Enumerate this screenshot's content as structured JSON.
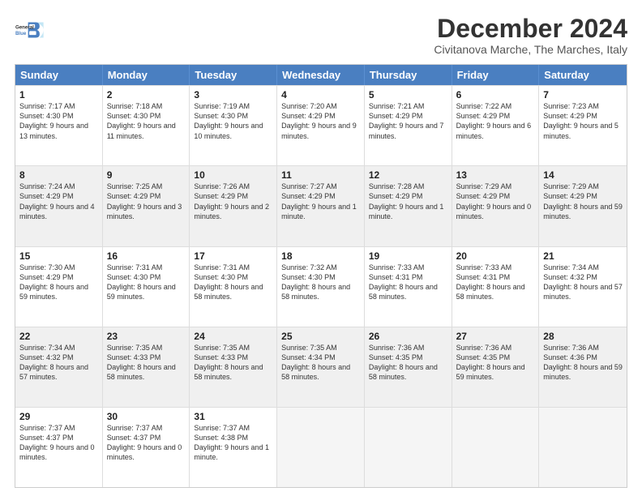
{
  "logo": {
    "line1": "General",
    "line2": "Blue"
  },
  "title": "December 2024",
  "subtitle": "Civitanova Marche, The Marches, Italy",
  "days": [
    "Sunday",
    "Monday",
    "Tuesday",
    "Wednesday",
    "Thursday",
    "Friday",
    "Saturday"
  ],
  "weeks": [
    [
      {
        "day": "1",
        "info": "Sunrise: 7:17 AM\nSunset: 4:30 PM\nDaylight: 9 hours and 13 minutes.",
        "shade": false
      },
      {
        "day": "2",
        "info": "Sunrise: 7:18 AM\nSunset: 4:30 PM\nDaylight: 9 hours and 11 minutes.",
        "shade": false
      },
      {
        "day": "3",
        "info": "Sunrise: 7:19 AM\nSunset: 4:30 PM\nDaylight: 9 hours and 10 minutes.",
        "shade": false
      },
      {
        "day": "4",
        "info": "Sunrise: 7:20 AM\nSunset: 4:29 PM\nDaylight: 9 hours and 9 minutes.",
        "shade": false
      },
      {
        "day": "5",
        "info": "Sunrise: 7:21 AM\nSunset: 4:29 PM\nDaylight: 9 hours and 7 minutes.",
        "shade": false
      },
      {
        "day": "6",
        "info": "Sunrise: 7:22 AM\nSunset: 4:29 PM\nDaylight: 9 hours and 6 minutes.",
        "shade": false
      },
      {
        "day": "7",
        "info": "Sunrise: 7:23 AM\nSunset: 4:29 PM\nDaylight: 9 hours and 5 minutes.",
        "shade": false
      }
    ],
    [
      {
        "day": "8",
        "info": "Sunrise: 7:24 AM\nSunset: 4:29 PM\nDaylight: 9 hours and 4 minutes.",
        "shade": true
      },
      {
        "day": "9",
        "info": "Sunrise: 7:25 AM\nSunset: 4:29 PM\nDaylight: 9 hours and 3 minutes.",
        "shade": true
      },
      {
        "day": "10",
        "info": "Sunrise: 7:26 AM\nSunset: 4:29 PM\nDaylight: 9 hours and 2 minutes.",
        "shade": true
      },
      {
        "day": "11",
        "info": "Sunrise: 7:27 AM\nSunset: 4:29 PM\nDaylight: 9 hours and 1 minute.",
        "shade": true
      },
      {
        "day": "12",
        "info": "Sunrise: 7:28 AM\nSunset: 4:29 PM\nDaylight: 9 hours and 1 minute.",
        "shade": true
      },
      {
        "day": "13",
        "info": "Sunrise: 7:29 AM\nSunset: 4:29 PM\nDaylight: 9 hours and 0 minutes.",
        "shade": true
      },
      {
        "day": "14",
        "info": "Sunrise: 7:29 AM\nSunset: 4:29 PM\nDaylight: 8 hours and 59 minutes.",
        "shade": true
      }
    ],
    [
      {
        "day": "15",
        "info": "Sunrise: 7:30 AM\nSunset: 4:29 PM\nDaylight: 8 hours and 59 minutes.",
        "shade": false
      },
      {
        "day": "16",
        "info": "Sunrise: 7:31 AM\nSunset: 4:30 PM\nDaylight: 8 hours and 59 minutes.",
        "shade": false
      },
      {
        "day": "17",
        "info": "Sunrise: 7:31 AM\nSunset: 4:30 PM\nDaylight: 8 hours and 58 minutes.",
        "shade": false
      },
      {
        "day": "18",
        "info": "Sunrise: 7:32 AM\nSunset: 4:30 PM\nDaylight: 8 hours and 58 minutes.",
        "shade": false
      },
      {
        "day": "19",
        "info": "Sunrise: 7:33 AM\nSunset: 4:31 PM\nDaylight: 8 hours and 58 minutes.",
        "shade": false
      },
      {
        "day": "20",
        "info": "Sunrise: 7:33 AM\nSunset: 4:31 PM\nDaylight: 8 hours and 58 minutes.",
        "shade": false
      },
      {
        "day": "21",
        "info": "Sunrise: 7:34 AM\nSunset: 4:32 PM\nDaylight: 8 hours and 57 minutes.",
        "shade": false
      }
    ],
    [
      {
        "day": "22",
        "info": "Sunrise: 7:34 AM\nSunset: 4:32 PM\nDaylight: 8 hours and 57 minutes.",
        "shade": true
      },
      {
        "day": "23",
        "info": "Sunrise: 7:35 AM\nSunset: 4:33 PM\nDaylight: 8 hours and 58 minutes.",
        "shade": true
      },
      {
        "day": "24",
        "info": "Sunrise: 7:35 AM\nSunset: 4:33 PM\nDaylight: 8 hours and 58 minutes.",
        "shade": true
      },
      {
        "day": "25",
        "info": "Sunrise: 7:35 AM\nSunset: 4:34 PM\nDaylight: 8 hours and 58 minutes.",
        "shade": true
      },
      {
        "day": "26",
        "info": "Sunrise: 7:36 AM\nSunset: 4:35 PM\nDaylight: 8 hours and 58 minutes.",
        "shade": true
      },
      {
        "day": "27",
        "info": "Sunrise: 7:36 AM\nSunset: 4:35 PM\nDaylight: 8 hours and 59 minutes.",
        "shade": true
      },
      {
        "day": "28",
        "info": "Sunrise: 7:36 AM\nSunset: 4:36 PM\nDaylight: 8 hours and 59 minutes.",
        "shade": true
      }
    ],
    [
      {
        "day": "29",
        "info": "Sunrise: 7:37 AM\nSunset: 4:37 PM\nDaylight: 9 hours and 0 minutes.",
        "shade": false
      },
      {
        "day": "30",
        "info": "Sunrise: 7:37 AM\nSunset: 4:37 PM\nDaylight: 9 hours and 0 minutes.",
        "shade": false
      },
      {
        "day": "31",
        "info": "Sunrise: 7:37 AM\nSunset: 4:38 PM\nDaylight: 9 hours and 1 minute.",
        "shade": false
      },
      {
        "day": "",
        "info": "",
        "shade": false,
        "empty": true
      },
      {
        "day": "",
        "info": "",
        "shade": false,
        "empty": true
      },
      {
        "day": "",
        "info": "",
        "shade": false,
        "empty": true
      },
      {
        "day": "",
        "info": "",
        "shade": false,
        "empty": true
      }
    ]
  ]
}
